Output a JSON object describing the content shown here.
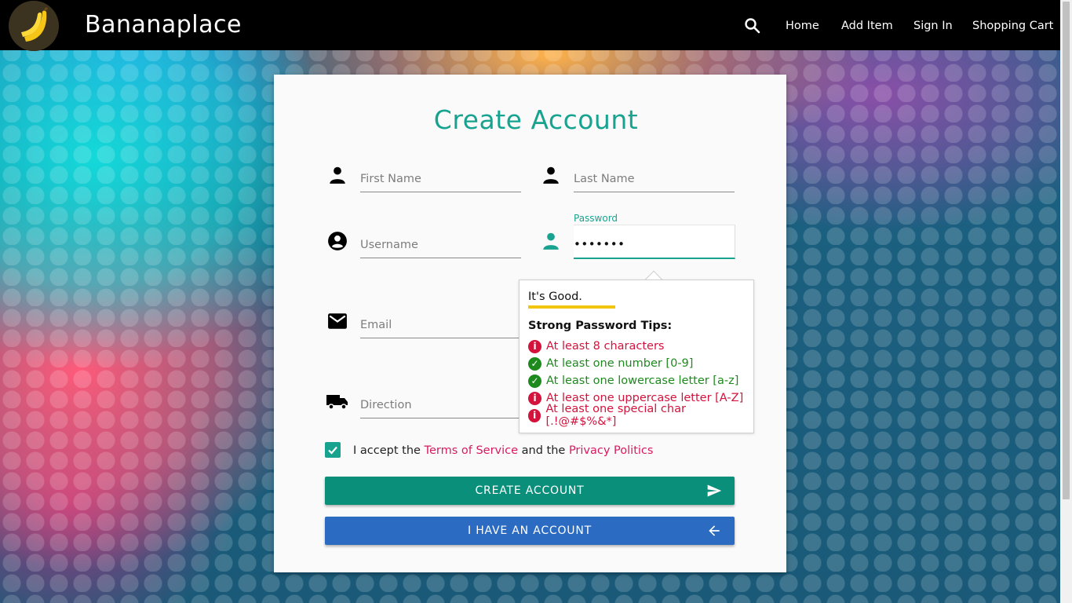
{
  "navbar": {
    "brand": "Bananaplace",
    "links": [
      "Home",
      "Add Item",
      "Sign In",
      "Shopping Cart"
    ],
    "search_icon": "search-icon"
  },
  "form": {
    "title": "Create Account",
    "first_name": {
      "placeholder": "First Name",
      "value": ""
    },
    "last_name": {
      "placeholder": "Last Name",
      "value": ""
    },
    "username": {
      "placeholder": "Username",
      "value": ""
    },
    "password": {
      "label": "Password",
      "value": "•••••••"
    },
    "email": {
      "placeholder": "Email",
      "value": ""
    },
    "direction": {
      "placeholder": "Direction",
      "value": ""
    },
    "accept": {
      "prefix": "I accept the",
      "terms": "Terms of Service",
      "middle": "and the",
      "privacy": "Privacy Politics",
      "checked": true
    },
    "create_button": "CREATE ACCOUNT",
    "account_button": "I HAVE AN ACCOUNT"
  },
  "password_tip": {
    "strength": "It's Good.",
    "heading": "Strong Password Tips:",
    "rules": [
      {
        "text": "At least 8 characters",
        "met": false
      },
      {
        "text": "At least one number [0-9]",
        "met": true
      },
      {
        "text": "At least one lowercase letter [a-z]",
        "met": true
      },
      {
        "text": "At least one uppercase letter [A-Z]",
        "met": false
      },
      {
        "text": "At least one special char [.!@#$%&*]",
        "met": false
      }
    ]
  },
  "colors": {
    "accent": "#17a38f",
    "link": "#d81b60",
    "error": "#d4123c",
    "success": "#1e8a1e",
    "primary_button": "#0a8f7b",
    "secondary_button": "#2b6bc2"
  }
}
